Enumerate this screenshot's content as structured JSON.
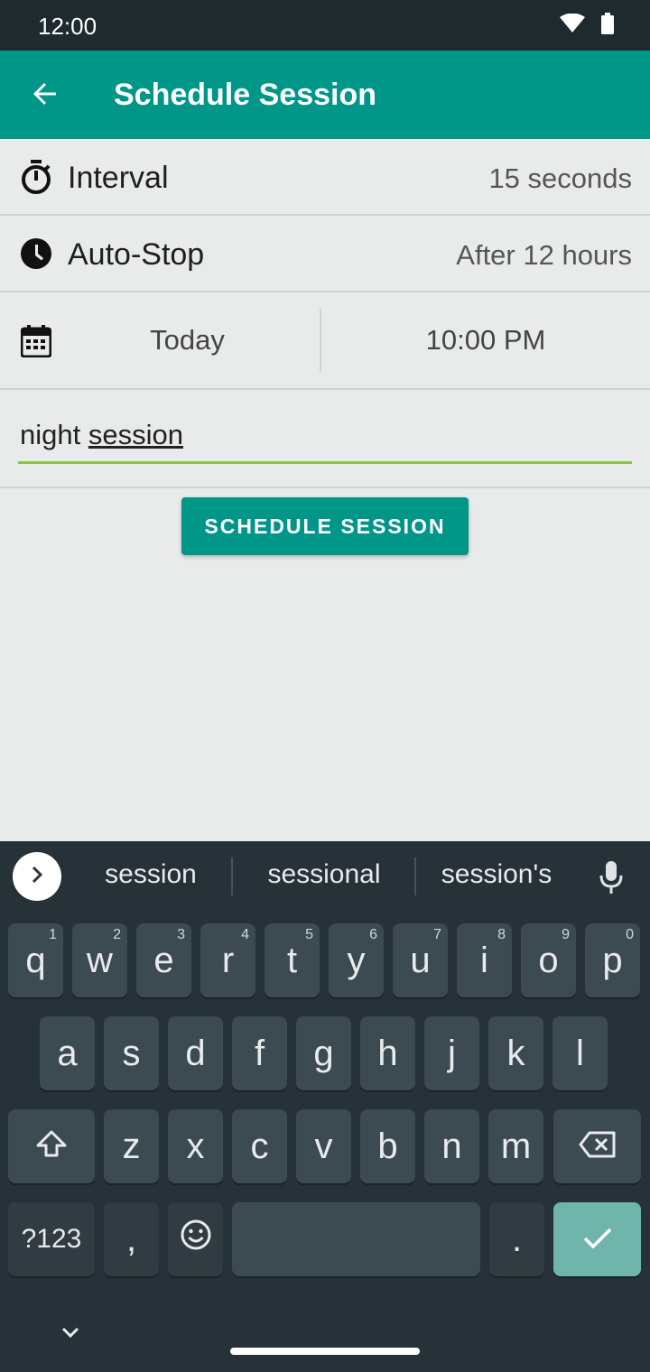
{
  "status_bar": {
    "time": "12:00"
  },
  "app_bar": {
    "title": "Schedule Session"
  },
  "interval": {
    "label": "Interval",
    "value": "15 seconds"
  },
  "auto_stop": {
    "label": "Auto-Stop",
    "value": "After 12 hours"
  },
  "schedule": {
    "date": "Today",
    "time": "10:00 PM"
  },
  "session_name": {
    "value_plain": "night ",
    "value_underlined": "session"
  },
  "action_button": {
    "label": "SCHEDULE SESSION"
  },
  "keyboard": {
    "suggestions": [
      "session",
      "sessional",
      "session's"
    ],
    "row1": [
      {
        "k": "q",
        "h": "1"
      },
      {
        "k": "w",
        "h": "2"
      },
      {
        "k": "e",
        "h": "3"
      },
      {
        "k": "r",
        "h": "4"
      },
      {
        "k": "t",
        "h": "5"
      },
      {
        "k": "y",
        "h": "6"
      },
      {
        "k": "u",
        "h": "7"
      },
      {
        "k": "i",
        "h": "8"
      },
      {
        "k": "o",
        "h": "9"
      },
      {
        "k": "p",
        "h": "0"
      }
    ],
    "row2": [
      "a",
      "s",
      "d",
      "f",
      "g",
      "h",
      "j",
      "k",
      "l"
    ],
    "row3": [
      "z",
      "x",
      "c",
      "v",
      "b",
      "n",
      "m"
    ],
    "symbols_label": "?123",
    "comma": ",",
    "period": "."
  },
  "colors": {
    "primary": "#009688",
    "accent_underline": "#8bc34a",
    "keyboard_bg": "#263238",
    "key_bg": "#3c4a51",
    "done_key": "#6fb5ab"
  }
}
